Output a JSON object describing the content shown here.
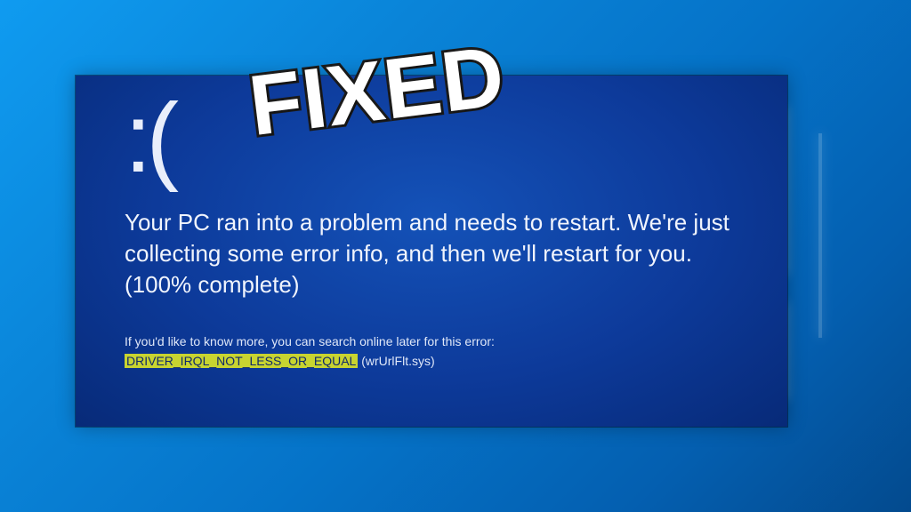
{
  "bsod": {
    "sad_face": ":(",
    "message": "Your PC ran into a problem and needs to restart. We're just collecting some error info, and then we'll restart for you. (100% complete)",
    "hint": "If you'd like to know more, you can search online later for this error:",
    "error_code": "DRIVER_IRQL_NOT_LESS_OR_EQUAL",
    "error_file": "(wrUrlFlt.sys)"
  },
  "overlay": {
    "fixed_text": "FIXED"
  }
}
